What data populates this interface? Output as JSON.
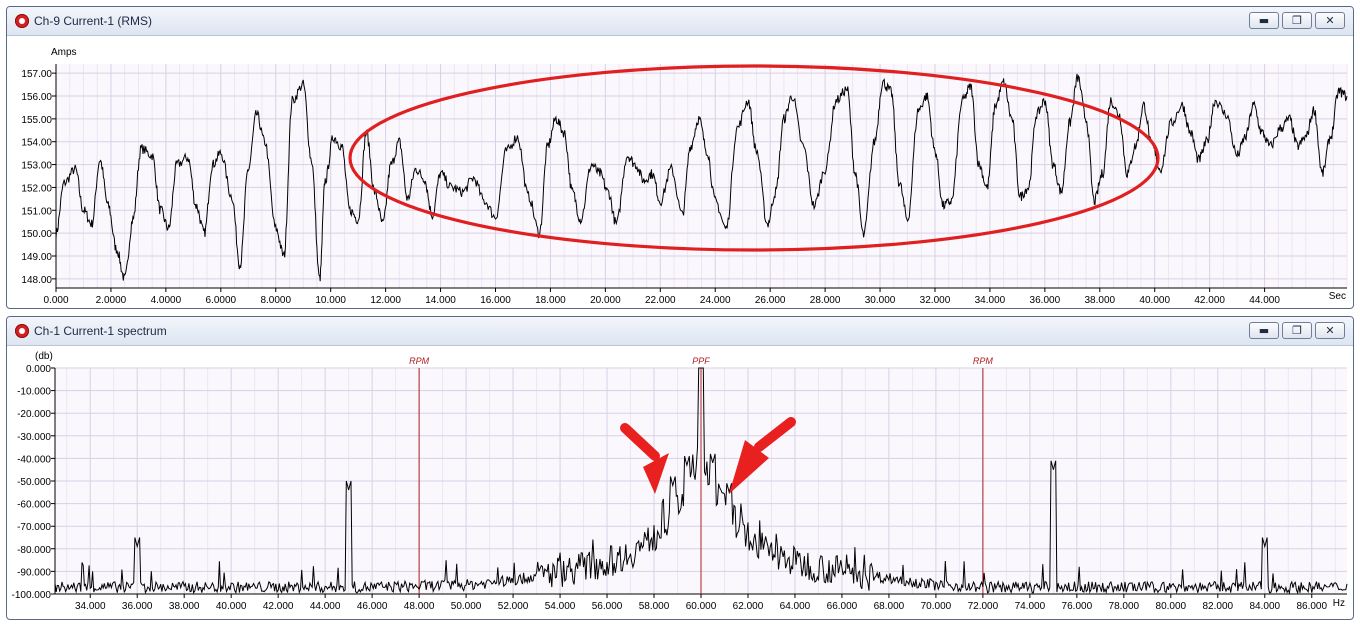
{
  "windows": [
    {
      "title": "Ch-9 Current-1 (RMS)",
      "buttons": {
        "minimize": "▬",
        "restore": "❐",
        "close": "✕"
      },
      "chart_data": {
        "type": "line",
        "ylabel": "Amps",
        "xlabel": "Sec",
        "xlim": [
          0,
          47.0
        ],
        "ylim": [
          147.6,
          157.4
        ],
        "xticks": [
          "0.000",
          "2.0000",
          "4.0000",
          "6.0000",
          "8.0000",
          "10.000",
          "12.000",
          "14.000",
          "16.000",
          "18.000",
          "20.000",
          "22.000",
          "24.000",
          "26.000",
          "28.000",
          "30.000",
          "32.000",
          "34.000",
          "36.000",
          "38.000",
          "40.000",
          "42.000",
          "44.000"
        ],
        "yticks": [
          "148.00",
          "149.00",
          "150.00",
          "151.00",
          "152.00",
          "153.00",
          "154.00",
          "155.00",
          "156.00",
          "157.00"
        ],
        "grid": true,
        "series_color": "#000000",
        "series": [
          {
            "x": [
              0,
              0.3,
              0.7,
              1.0,
              1.3,
              1.6,
              1.9,
              2.2,
              2.5,
              2.8,
              3.1,
              3.5,
              3.8,
              4.1,
              4.4,
              4.8,
              5.1,
              5.4,
              5.7,
              6.0,
              6.4,
              6.7,
              7.0,
              7.3,
              7.6,
              8.0,
              8.3,
              8.6,
              9.0,
              9.3,
              9.6,
              9.8,
              10.1,
              10.4,
              10.7,
              11.0,
              11.3,
              11.6,
              11.9,
              12.2,
              12.5,
              12.8,
              13.1,
              13.4,
              13.7,
              14.0,
              14.4,
              14.8,
              15.2,
              15.6,
              16.0,
              16.4,
              16.8,
              17.2,
              17.6,
              17.9,
              18.2,
              18.5,
              18.8,
              19.1,
              19.5,
              19.8,
              20.1,
              20.4,
              20.8,
              21.1,
              21.4,
              21.7,
              22.0,
              22.4,
              22.8,
              23.1,
              23.4,
              23.7,
              24.0,
              24.4,
              24.8,
              25.2,
              25.5,
              25.9,
              26.2,
              26.5,
              26.8,
              27.2,
              27.6,
              28.0,
              28.4,
              28.8,
              29.1,
              29.4,
              29.8,
              30.1,
              30.4,
              30.7,
              31.0,
              31.4,
              31.7,
              32.0,
              32.3,
              32.6,
              33.0,
              33.3,
              33.6,
              33.9,
              34.2,
              34.5,
              34.8,
              35.1,
              35.4,
              35.7,
              36.0,
              36.3,
              36.6,
              36.9,
              37.2,
              37.5,
              37.8,
              38.1,
              38.4,
              38.7,
              39.0,
              39.3,
              39.6,
              39.9,
              40.2,
              40.6,
              41.0,
              41.3,
              41.6,
              41.9,
              42.2,
              42.6,
              43.0,
              43.3,
              43.6,
              43.9,
              44.2,
              44.6,
              44.9,
              45.2,
              45.5,
              45.8,
              46.1,
              46.4,
              46.7,
              47.0
            ],
            "y": [
              150.0,
              152.2,
              152.8,
              151.0,
              150.4,
              153.2,
              151.2,
              149.3,
              148.0,
              150.6,
              153.7,
              153.4,
              151.0,
              150.2,
              153.0,
              153.3,
              151.2,
              150.0,
              153.0,
              153.5,
              151.6,
              148.6,
              152.8,
              155.2,
              154.0,
              150.2,
              149.0,
              155.8,
              156.5,
              153.2,
              148.0,
              152.3,
              154.2,
              153.8,
              151.0,
              150.6,
              154.4,
              151.8,
              150.4,
              153.0,
              154.0,
              151.5,
              152.8,
              152.4,
              150.8,
              152.6,
              152.0,
              151.8,
              152.4,
              151.4,
              150.7,
              153.6,
              154.2,
              151.6,
              150.0,
              153.8,
              155.0,
              154.4,
              151.8,
              150.6,
              153.0,
              152.6,
              151.8,
              150.4,
              153.4,
              153.0,
              152.3,
              152.6,
              151.4,
              152.8,
              150.8,
              153.8,
              155.0,
              153.6,
              151.4,
              150.2,
              154.6,
              155.8,
              153.6,
              150.4,
              151.8,
              155.0,
              156.0,
              153.8,
              151.2,
              152.8,
              155.8,
              156.3,
              152.6,
              149.9,
              154.0,
              156.6,
              156.2,
              152.2,
              150.6,
              155.4,
              156.0,
              153.6,
              151.2,
              151.4,
              155.8,
              156.4,
              153.0,
              152.0,
              155.6,
              156.6,
              155.0,
              151.6,
              152.0,
              155.2,
              155.8,
              153.0,
              151.8,
              154.8,
              156.8,
              155.0,
              151.4,
              152.6,
              155.8,
              155.2,
              152.6,
              153.8,
              155.6,
              153.8,
              152.8,
              154.8,
              155.6,
              154.4,
              153.2,
              154.0,
              155.8,
              155.2,
              153.4,
              154.2,
              155.6,
              154.4,
              153.8,
              154.6,
              155.0,
              153.8,
              154.2,
              155.4,
              152.6,
              154.2,
              156.2,
              156.0
            ]
          }
        ],
        "annotations": [
          {
            "type": "ellipse",
            "color": "#e02020"
          }
        ]
      }
    },
    {
      "title": "Ch-1 Current-1 spectrum",
      "buttons": {
        "minimize": "▬",
        "restore": "❐",
        "close": "✕"
      },
      "chart_data": {
        "type": "line",
        "ylabel": "(db)",
        "xlabel": "Hz",
        "xlim": [
          32.5,
          87.5
        ],
        "ylim": [
          -100,
          0
        ],
        "xticks": [
          "34.000",
          "36.000",
          "38.000",
          "40.000",
          "42.000",
          "44.000",
          "46.000",
          "48.000",
          "50.000",
          "52.000",
          "54.000",
          "56.000",
          "58.000",
          "60.000",
          "62.000",
          "64.000",
          "66.000",
          "68.000",
          "70.000",
          "72.000",
          "74.000",
          "76.000",
          "78.000",
          "80.000",
          "82.000",
          "84.000",
          "86.000"
        ],
        "yticks": [
          "0.000",
          "-10.000",
          "-20.000",
          "-30.000",
          "-40.000",
          "-50.000",
          "-60.000",
          "-70.000",
          "-80.000",
          "-90.000",
          "-100.000"
        ],
        "grid": true,
        "series_color": "#000000",
        "markers": [
          {
            "label": "RPM",
            "x": 48.0,
            "color": "#b02020"
          },
          {
            "label": "PPF",
            "x": 60.0,
            "color": "#b02020"
          },
          {
            "label": "RPM",
            "x": 72.0,
            "color": "#b02020"
          }
        ],
        "peaks": [
          {
            "x": 36.0,
            "y": -79
          },
          {
            "x": 45.0,
            "y": -54
          },
          {
            "x": 58.8,
            "y": -52
          },
          {
            "x": 59.4,
            "y": -43
          },
          {
            "x": 60.0,
            "y": 0
          },
          {
            "x": 60.5,
            "y": -42
          },
          {
            "x": 61.2,
            "y": -55
          },
          {
            "x": 75.0,
            "y": -45
          },
          {
            "x": 84.0,
            "y": -79
          }
        ],
        "envelope": {
          "x": [
            32.5,
            40,
            46,
            50,
            52,
            54,
            56,
            57,
            58,
            59,
            60,
            61,
            62,
            63,
            64,
            66,
            68,
            70,
            72,
            76,
            80,
            87.5
          ],
          "y": [
            -97,
            -97,
            -97,
            -96,
            -94,
            -90,
            -86,
            -82,
            -75,
            -62,
            -40,
            -62,
            -75,
            -82,
            -86,
            -90,
            -93,
            -96,
            -97,
            -97,
            -97,
            -97
          ]
        },
        "annotations": [
          {
            "type": "arrow",
            "color": "#e82020"
          },
          {
            "type": "arrow",
            "color": "#e82020"
          }
        ]
      }
    }
  ]
}
